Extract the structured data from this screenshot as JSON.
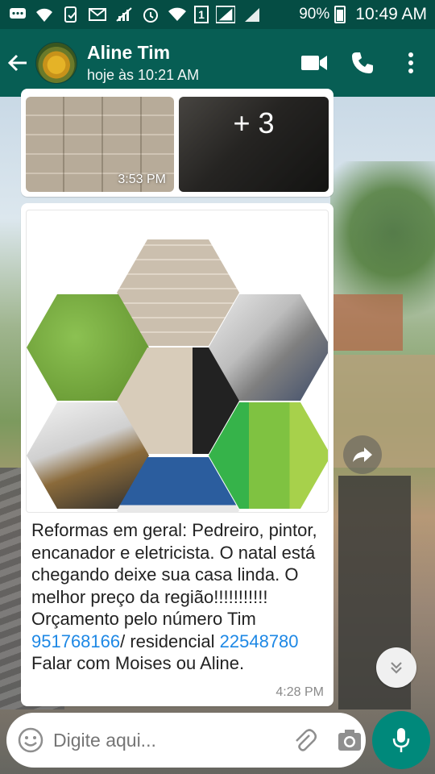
{
  "status_bar": {
    "sim_slot": "1",
    "battery_percent": "90%",
    "time": "10:49 AM"
  },
  "header": {
    "contact_name": "Aline Tim",
    "last_seen": "hoje às 10:21 AM"
  },
  "messages": [
    {
      "type": "image-album",
      "more_count": "+ 3",
      "time": "3:53 PM"
    },
    {
      "type": "image-caption",
      "caption_parts": {
        "text1": "Reformas em geral: Pedreiro, pintor, encanador e eletricista. O natal está chegando deixe sua casa linda. O melhor preço da região!!!!!!!!!!! Orçamento pelo número Tim ",
        "phone_mobile": "951768166",
        "text2": "/ residencial ",
        "phone_home": "22548780",
        "text3": " Falar com Moises ou Aline."
      },
      "time": "4:28 PM"
    }
  ],
  "composer": {
    "placeholder": "Digite aqui..."
  },
  "colors": {
    "header": "#075e54",
    "status_bar": "#054d44",
    "accent": "#00897b",
    "link": "#1e88e5"
  },
  "icons": [
    "back-arrow-icon",
    "video-call-icon",
    "phone-icon",
    "more-vert-icon",
    "forward-icon",
    "double-chevron-down-icon",
    "emoji-icon",
    "attach-icon",
    "camera-icon",
    "mic-icon"
  ]
}
